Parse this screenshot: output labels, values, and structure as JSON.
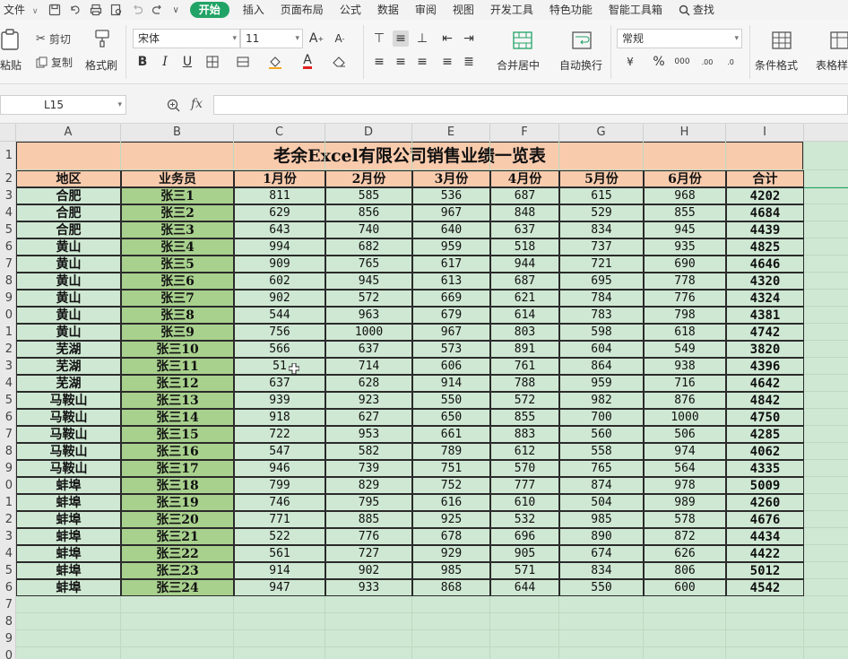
{
  "menu": {
    "file": "文件",
    "tabs": [
      "开始",
      "插入",
      "页面布局",
      "公式",
      "数据",
      "审阅",
      "视图",
      "开发工具",
      "特色功能",
      "智能工具箱"
    ],
    "active_tab": "开始",
    "search": "查找"
  },
  "ribbon": {
    "paste": "粘贴",
    "cut": "剪切",
    "copy": "复制",
    "format_painter": "格式刷",
    "font_name": "宋体",
    "font_size": "11",
    "merge_center": "合并居中",
    "wrap_text": "自动换行",
    "number_format": "常规",
    "conditional_format": "条件格式",
    "table_style": "表格样"
  },
  "formula_bar": {
    "cell_ref": "L15",
    "fx": "fx",
    "formula": ""
  },
  "colors": {
    "accent": "#21a366",
    "sheet_bg": "#cfe8d3",
    "title_fill": "#f9cbad",
    "name_fill": "#a9d18e"
  },
  "grid": {
    "columns": [
      "A",
      "B",
      "C",
      "D",
      "E",
      "F",
      "G",
      "H",
      "I"
    ],
    "row_labels": [
      "1",
      "2",
      "3",
      "4",
      "5",
      "6",
      "7",
      "8",
      "9",
      "0",
      "1",
      "2",
      "3",
      "4",
      "5",
      "6",
      "7",
      "8",
      "9",
      "0",
      "1",
      "2",
      "3",
      "4",
      "5",
      "6",
      "7",
      "8",
      "9",
      "0"
    ]
  },
  "table": {
    "title": "老余Excel有限公司销售业绩一览表",
    "headers": [
      "地区",
      "业务员",
      "1月份",
      "2月份",
      "3月份",
      "4月份",
      "5月份",
      "6月份",
      "合计"
    ],
    "rows": [
      [
        "合肥",
        "张三1",
        "811",
        "585",
        "536",
        "687",
        "615",
        "968",
        "4202"
      ],
      [
        "合肥",
        "张三2",
        "629",
        "856",
        "967",
        "848",
        "529",
        "855",
        "4684"
      ],
      [
        "合肥",
        "张三3",
        "643",
        "740",
        "640",
        "637",
        "834",
        "945",
        "4439"
      ],
      [
        "黄山",
        "张三4",
        "994",
        "682",
        "959",
        "518",
        "737",
        "935",
        "4825"
      ],
      [
        "黄山",
        "张三5",
        "909",
        "765",
        "617",
        "944",
        "721",
        "690",
        "4646"
      ],
      [
        "黄山",
        "张三6",
        "602",
        "945",
        "613",
        "687",
        "695",
        "778",
        "4320"
      ],
      [
        "黄山",
        "张三7",
        "902",
        "572",
        "669",
        "621",
        "784",
        "776",
        "4324"
      ],
      [
        "黄山",
        "张三8",
        "544",
        "963",
        "679",
        "614",
        "783",
        "798",
        "4381"
      ],
      [
        "黄山",
        "张三9",
        "756",
        "1000",
        "967",
        "803",
        "598",
        "618",
        "4742"
      ],
      [
        "芜湖",
        "张三10",
        "566",
        "637",
        "573",
        "891",
        "604",
        "549",
        "3820"
      ],
      [
        "芜湖",
        "张三11",
        "51",
        "714",
        "606",
        "761",
        "864",
        "938",
        "4396"
      ],
      [
        "芜湖",
        "张三12",
        "637",
        "628",
        "914",
        "788",
        "959",
        "716",
        "4642"
      ],
      [
        "马鞍山",
        "张三13",
        "939",
        "923",
        "550",
        "572",
        "982",
        "876",
        "4842"
      ],
      [
        "马鞍山",
        "张三14",
        "918",
        "627",
        "650",
        "855",
        "700",
        "1000",
        "4750"
      ],
      [
        "马鞍山",
        "张三15",
        "722",
        "953",
        "661",
        "883",
        "560",
        "506",
        "4285"
      ],
      [
        "马鞍山",
        "张三16",
        "547",
        "582",
        "789",
        "612",
        "558",
        "974",
        "4062"
      ],
      [
        "马鞍山",
        "张三17",
        "946",
        "739",
        "751",
        "570",
        "765",
        "564",
        "4335"
      ],
      [
        "蚌埠",
        "张三18",
        "799",
        "829",
        "752",
        "777",
        "874",
        "978",
        "5009"
      ],
      [
        "蚌埠",
        "张三19",
        "746",
        "795",
        "616",
        "610",
        "504",
        "989",
        "4260"
      ],
      [
        "蚌埠",
        "张三20",
        "771",
        "885",
        "925",
        "532",
        "985",
        "578",
        "4676"
      ],
      [
        "蚌埠",
        "张三21",
        "522",
        "776",
        "678",
        "696",
        "890",
        "872",
        "4434"
      ],
      [
        "蚌埠",
        "张三22",
        "561",
        "727",
        "929",
        "905",
        "674",
        "626",
        "4422"
      ],
      [
        "蚌埠",
        "张三23",
        "914",
        "902",
        "985",
        "571",
        "834",
        "806",
        "5012"
      ],
      [
        "蚌埠",
        "张三24",
        "947",
        "933",
        "868",
        "644",
        "550",
        "600",
        "4542"
      ]
    ]
  }
}
